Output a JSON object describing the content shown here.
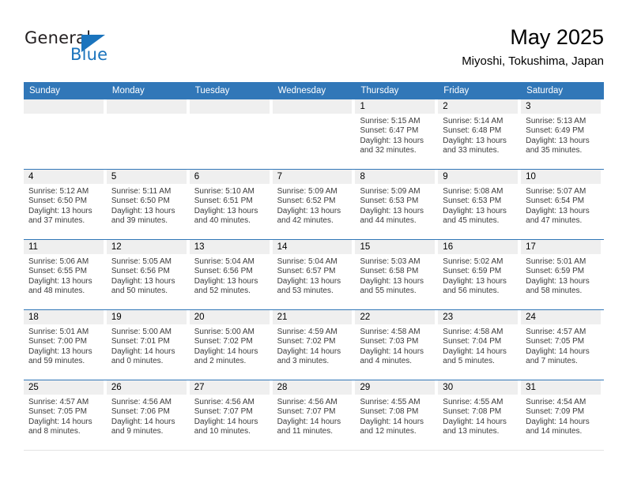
{
  "brand": {
    "name_top": "General",
    "name_bottom": "Blue",
    "accent_color": "#1b74bd",
    "triangle_icon": "triangle-icon"
  },
  "header": {
    "title": "May 2025",
    "subtitle": "Miyoshi, Tokushima, Japan"
  },
  "theme": {
    "header_blue": "#3177b8",
    "band_gray": "#efefef",
    "text_dark": "#3b3b3b"
  },
  "calendar": {
    "weekday_headers": [
      "Sunday",
      "Monday",
      "Tuesday",
      "Wednesday",
      "Thursday",
      "Friday",
      "Saturday"
    ],
    "weeks": [
      [
        {
          "day": "",
          "empty": true
        },
        {
          "day": "",
          "empty": true
        },
        {
          "day": "",
          "empty": true
        },
        {
          "day": "",
          "empty": true
        },
        {
          "day": "1",
          "sunrise": "Sunrise: 5:15 AM",
          "sunset": "Sunset: 6:47 PM",
          "daylight": "Daylight: 13 hours and 32 minutes."
        },
        {
          "day": "2",
          "sunrise": "Sunrise: 5:14 AM",
          "sunset": "Sunset: 6:48 PM",
          "daylight": "Daylight: 13 hours and 33 minutes."
        },
        {
          "day": "3",
          "sunrise": "Sunrise: 5:13 AM",
          "sunset": "Sunset: 6:49 PM",
          "daylight": "Daylight: 13 hours and 35 minutes."
        }
      ],
      [
        {
          "day": "4",
          "sunrise": "Sunrise: 5:12 AM",
          "sunset": "Sunset: 6:50 PM",
          "daylight": "Daylight: 13 hours and 37 minutes."
        },
        {
          "day": "5",
          "sunrise": "Sunrise: 5:11 AM",
          "sunset": "Sunset: 6:50 PM",
          "daylight": "Daylight: 13 hours and 39 minutes."
        },
        {
          "day": "6",
          "sunrise": "Sunrise: 5:10 AM",
          "sunset": "Sunset: 6:51 PM",
          "daylight": "Daylight: 13 hours and 40 minutes."
        },
        {
          "day": "7",
          "sunrise": "Sunrise: 5:09 AM",
          "sunset": "Sunset: 6:52 PM",
          "daylight": "Daylight: 13 hours and 42 minutes."
        },
        {
          "day": "8",
          "sunrise": "Sunrise: 5:09 AM",
          "sunset": "Sunset: 6:53 PM",
          "daylight": "Daylight: 13 hours and 44 minutes."
        },
        {
          "day": "9",
          "sunrise": "Sunrise: 5:08 AM",
          "sunset": "Sunset: 6:53 PM",
          "daylight": "Daylight: 13 hours and 45 minutes."
        },
        {
          "day": "10",
          "sunrise": "Sunrise: 5:07 AM",
          "sunset": "Sunset: 6:54 PM",
          "daylight": "Daylight: 13 hours and 47 minutes."
        }
      ],
      [
        {
          "day": "11",
          "sunrise": "Sunrise: 5:06 AM",
          "sunset": "Sunset: 6:55 PM",
          "daylight": "Daylight: 13 hours and 48 minutes."
        },
        {
          "day": "12",
          "sunrise": "Sunrise: 5:05 AM",
          "sunset": "Sunset: 6:56 PM",
          "daylight": "Daylight: 13 hours and 50 minutes."
        },
        {
          "day": "13",
          "sunrise": "Sunrise: 5:04 AM",
          "sunset": "Sunset: 6:56 PM",
          "daylight": "Daylight: 13 hours and 52 minutes."
        },
        {
          "day": "14",
          "sunrise": "Sunrise: 5:04 AM",
          "sunset": "Sunset: 6:57 PM",
          "daylight": "Daylight: 13 hours and 53 minutes."
        },
        {
          "day": "15",
          "sunrise": "Sunrise: 5:03 AM",
          "sunset": "Sunset: 6:58 PM",
          "daylight": "Daylight: 13 hours and 55 minutes."
        },
        {
          "day": "16",
          "sunrise": "Sunrise: 5:02 AM",
          "sunset": "Sunset: 6:59 PM",
          "daylight": "Daylight: 13 hours and 56 minutes."
        },
        {
          "day": "17",
          "sunrise": "Sunrise: 5:01 AM",
          "sunset": "Sunset: 6:59 PM",
          "daylight": "Daylight: 13 hours and 58 minutes."
        }
      ],
      [
        {
          "day": "18",
          "sunrise": "Sunrise: 5:01 AM",
          "sunset": "Sunset: 7:00 PM",
          "daylight": "Daylight: 13 hours and 59 minutes."
        },
        {
          "day": "19",
          "sunrise": "Sunrise: 5:00 AM",
          "sunset": "Sunset: 7:01 PM",
          "daylight": "Daylight: 14 hours and 0 minutes."
        },
        {
          "day": "20",
          "sunrise": "Sunrise: 5:00 AM",
          "sunset": "Sunset: 7:02 PM",
          "daylight": "Daylight: 14 hours and 2 minutes."
        },
        {
          "day": "21",
          "sunrise": "Sunrise: 4:59 AM",
          "sunset": "Sunset: 7:02 PM",
          "daylight": "Daylight: 14 hours and 3 minutes."
        },
        {
          "day": "22",
          "sunrise": "Sunrise: 4:58 AM",
          "sunset": "Sunset: 7:03 PM",
          "daylight": "Daylight: 14 hours and 4 minutes."
        },
        {
          "day": "23",
          "sunrise": "Sunrise: 4:58 AM",
          "sunset": "Sunset: 7:04 PM",
          "daylight": "Daylight: 14 hours and 5 minutes."
        },
        {
          "day": "24",
          "sunrise": "Sunrise: 4:57 AM",
          "sunset": "Sunset: 7:05 PM",
          "daylight": "Daylight: 14 hours and 7 minutes."
        }
      ],
      [
        {
          "day": "25",
          "sunrise": "Sunrise: 4:57 AM",
          "sunset": "Sunset: 7:05 PM",
          "daylight": "Daylight: 14 hours and 8 minutes."
        },
        {
          "day": "26",
          "sunrise": "Sunrise: 4:56 AM",
          "sunset": "Sunset: 7:06 PM",
          "daylight": "Daylight: 14 hours and 9 minutes."
        },
        {
          "day": "27",
          "sunrise": "Sunrise: 4:56 AM",
          "sunset": "Sunset: 7:07 PM",
          "daylight": "Daylight: 14 hours and 10 minutes."
        },
        {
          "day": "28",
          "sunrise": "Sunrise: 4:56 AM",
          "sunset": "Sunset: 7:07 PM",
          "daylight": "Daylight: 14 hours and 11 minutes."
        },
        {
          "day": "29",
          "sunrise": "Sunrise: 4:55 AM",
          "sunset": "Sunset: 7:08 PM",
          "daylight": "Daylight: 14 hours and 12 minutes."
        },
        {
          "day": "30",
          "sunrise": "Sunrise: 4:55 AM",
          "sunset": "Sunset: 7:08 PM",
          "daylight": "Daylight: 14 hours and 13 minutes."
        },
        {
          "day": "31",
          "sunrise": "Sunrise: 4:54 AM",
          "sunset": "Sunset: 7:09 PM",
          "daylight": "Daylight: 14 hours and 14 minutes."
        }
      ]
    ]
  }
}
